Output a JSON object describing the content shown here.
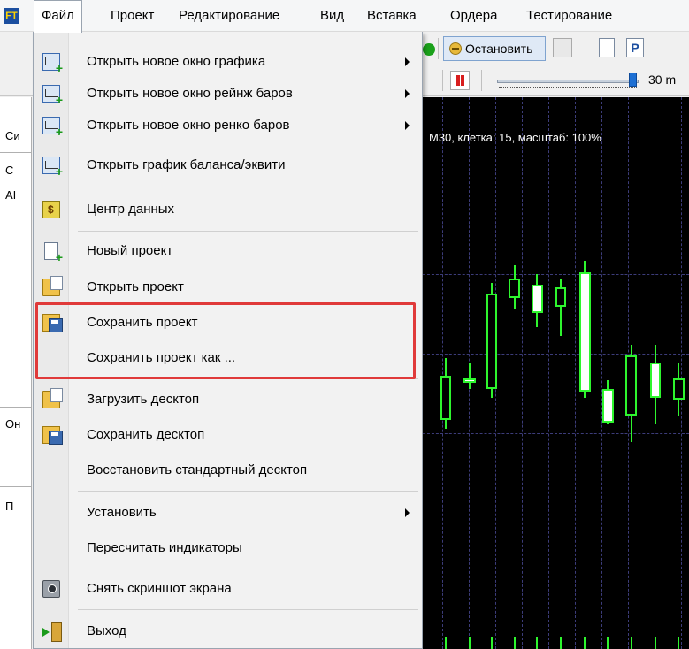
{
  "app": {
    "logo_text": "FT"
  },
  "menubar": {
    "items": [
      {
        "label": "Файл",
        "open": true
      },
      {
        "label": "Проект"
      },
      {
        "label": "Редактирование"
      },
      {
        "label": "Вид"
      },
      {
        "label": "Вставка"
      },
      {
        "label": "Ордера"
      },
      {
        "label": "Тестирование"
      }
    ]
  },
  "toolbar": {
    "stop_label": "Остановить",
    "p_icon_text": "P",
    "speed_value": "30 m"
  },
  "left_panel": {
    "row1": "Си",
    "row2": "С",
    "row3": "AI",
    "row4": "Он",
    "row5": "П"
  },
  "chart": {
    "info": "M30, клетка: 15, масштаб: 100%",
    "colors": {
      "background": "#000000",
      "candle": "#2ef52e",
      "grid": "#3c3c7a"
    }
  },
  "file_menu": {
    "items": [
      {
        "label": "Открыть новое окно графика",
        "icon": "chart-add-icon",
        "submenu": true
      },
      {
        "label": "Открыть новое окно рейнж баров",
        "icon": "chart-add-icon",
        "submenu": true
      },
      {
        "label": "Открыть новое окно ренко баров",
        "icon": "chart-add-icon",
        "submenu": true
      },
      {
        "label": "Открыть график баланса/эквити",
        "icon": "chart-add-icon",
        "submenu": false
      },
      {
        "label": "Центр данных",
        "icon": "data-center-icon",
        "submenu": false
      },
      {
        "label": "Новый проект",
        "icon": "new-project-icon",
        "submenu": false
      },
      {
        "label": "Открыть проект",
        "icon": "open-folder-icon",
        "submenu": false
      },
      {
        "label": "Сохранить проект",
        "icon": "save-folder-icon",
        "submenu": false
      },
      {
        "label": "Сохранить проект как ...",
        "icon": "",
        "submenu": false
      },
      {
        "label": "Загрузить десктоп",
        "icon": "open-folder-icon",
        "submenu": false
      },
      {
        "label": "Сохранить десктоп",
        "icon": "save-folder-icon",
        "submenu": false
      },
      {
        "label": "Восстановить стандартный десктоп",
        "icon": "",
        "submenu": false
      },
      {
        "label": "Установить",
        "icon": "",
        "submenu": true
      },
      {
        "label": "Пересчитать индикаторы",
        "icon": "",
        "submenu": false
      },
      {
        "label": "Снять скриншот экрана",
        "icon": "camera-icon",
        "submenu": false
      },
      {
        "label": "Выход",
        "icon": "exit-icon",
        "submenu": false
      }
    ],
    "highlight_color": "#e03a3a"
  }
}
